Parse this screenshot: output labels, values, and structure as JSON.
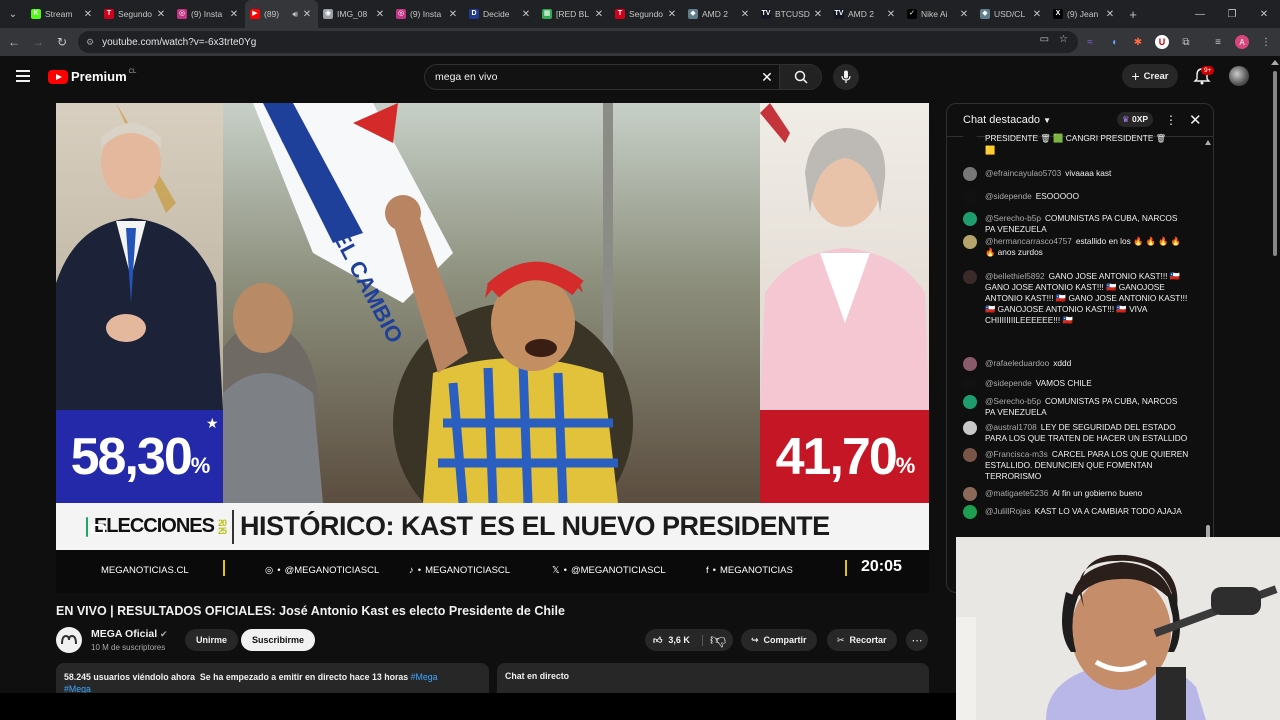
{
  "browser": {
    "tabs": [
      {
        "title": "Stream",
        "fav_color": "#53fc18",
        "fav_char": "K"
      },
      {
        "title": "Segundo",
        "fav_color": "#d0021b",
        "fav_char": "T"
      },
      {
        "title": "(9) Insta",
        "fav_color": "#c13584",
        "fav_char": "◎"
      },
      {
        "title": "(89)",
        "fav_color": "#ff0000",
        "fav_char": "▶",
        "active": true
      },
      {
        "title": "IMG_08",
        "fav_color": "#9aa0a6",
        "fav_char": "◉"
      },
      {
        "title": "(9) Insta",
        "fav_color": "#c13584",
        "fav_char": "◎"
      },
      {
        "title": "Decide",
        "fav_color": "#1f3a93",
        "fav_char": "D"
      },
      {
        "title": "[RED BL",
        "fav_color": "#34a853",
        "fav_char": "▦"
      },
      {
        "title": "Segundo",
        "fav_color": "#d0021b",
        "fav_char": "T"
      },
      {
        "title": "AMD 2",
        "fav_color": "#607d8b",
        "fav_char": "◆"
      },
      {
        "title": "BTCUSD",
        "fav_color": "#131722",
        "fav_char": "TV"
      },
      {
        "title": "AMD 2",
        "fav_color": "#131722",
        "fav_char": "TV"
      },
      {
        "title": "Nike Ai",
        "fav_color": "#000000",
        "fav_char": "✓"
      },
      {
        "title": "USD/CL",
        "fav_color": "#607d8b",
        "fav_char": "◆"
      },
      {
        "title": "(9) Jean",
        "fav_color": "#000000",
        "fav_char": "X"
      }
    ],
    "url": "youtube.com/watch?v=-6x3trte0Yg"
  },
  "youtube": {
    "logo_text": "Premium",
    "region": "CL",
    "search_value": "mega en vivo",
    "create_label": "Crear",
    "notif_count": "9+"
  },
  "video": {
    "pct_left": "58,30",
    "pct_right": "41,70",
    "pct_sign": "%",
    "elecciones_label": "ELECCIONES",
    "elecciones_year": "20 25",
    "headline": "HISTÓRICO: KAST ES EL NUEVO PRESIDENTE",
    "social": [
      "MEGANOTICIAS.CL",
      "@MEGANOTICIASCL",
      "MEGANOTICIASCL",
      "@MEGANOTICIASCL",
      "MEGANOTICIAS"
    ],
    "clock": "20:05"
  },
  "chat": {
    "title": "Chat destacado",
    "xp": "0XP",
    "messages": [
      {
        "author": "",
        "text": "PRESIDENTE 🗑 🟩 CANGRI PRESIDENTE 🗑",
        "color": "#0f0f0f"
      },
      {
        "author": "",
        "text": "🟨",
        "color": "#0f0f0f"
      },
      {
        "author": "@efraincayulao5703",
        "text": "vivaaaa kast",
        "color": "#777"
      },
      {
        "author": "@sidepende",
        "text": "ESOOOOO",
        "color": "#111"
      },
      {
        "author": "@Serecho-b5p",
        "text": "COMUNISTAS PA CUBA, NARCOS PA VENEZUELA",
        "color": "#1e9e6e"
      },
      {
        "author": "@hermancarrasco4757",
        "text": "estallido en los 🔥 🔥 🔥 🔥 🔥 anos zurdos",
        "color": "#b6a36b"
      },
      {
        "author": "@bellethiel5892",
        "text": "GANO JOSE ANTONIO KAST!!! 🇨🇱 GANO JOSE ANTONIO KAST!!! 🇨🇱 GANOJOSE ANTONIO KAST!!! 🇨🇱 GANO JOSE ANTONIO KAST!!! 🇨🇱 GANOJOSE ANTONIO KAST!!! 🇨🇱 VIVA CHIIIIIIIILEEEEEE!!! 🇨🇱",
        "color": "#3a2a2a"
      },
      {
        "author": "@rafaeleduardoo",
        "text": "xddd",
        "color": "#8a5a6a"
      },
      {
        "author": "@sidepende",
        "text": "VAMOS CHILE",
        "color": "#111"
      },
      {
        "author": "@Serecho-b5p",
        "text": "COMUNISTAS PA CUBA, NARCOS PA VENEZUELA",
        "color": "#1e9e6e"
      },
      {
        "author": "@austral1708",
        "text": "LEY DE SEGURIDAD DEL ESTADO PARA LOS QUE TRATEN DE HACER UN ESTALLIDO",
        "color": "#c8c8c8"
      },
      {
        "author": "@Francisca-m3s",
        "text": "CARCEL PARA LOS QUE QUIEREN ESTALLIDO. DENUNCIEN QUE FOMENTAN TERRORISMO",
        "color": "#795548"
      },
      {
        "author": "@matigaete5236",
        "text": "Al fin un gobierno bueno",
        "color": "#8b6a5a"
      },
      {
        "author": "@JulillRojas",
        "text": "KAST LO VA A CAMBIAR TODO AJAJA",
        "color": "#1e9e4e"
      }
    ]
  },
  "meta": {
    "title": "EN VIVO | RESULTADOS OFICIALES: José Antonio Kast es electo Presidente de Chile",
    "channel": "MEGA Oficial",
    "subscribers": "10 M de suscriptores",
    "join_label": "Unirme",
    "subscribe_label": "Suscribirme",
    "likes": "3,6 K",
    "share_label": "Compartir",
    "clip_label": "Recortar",
    "viewers": "58.245 usuarios viéndolo ahora",
    "started": "Se ha empezado a emitir en directo hace 13 horas",
    "hashtag": "#Mega",
    "hashtag2": "#Mega",
    "live_chat_label": "Chat en directo"
  }
}
